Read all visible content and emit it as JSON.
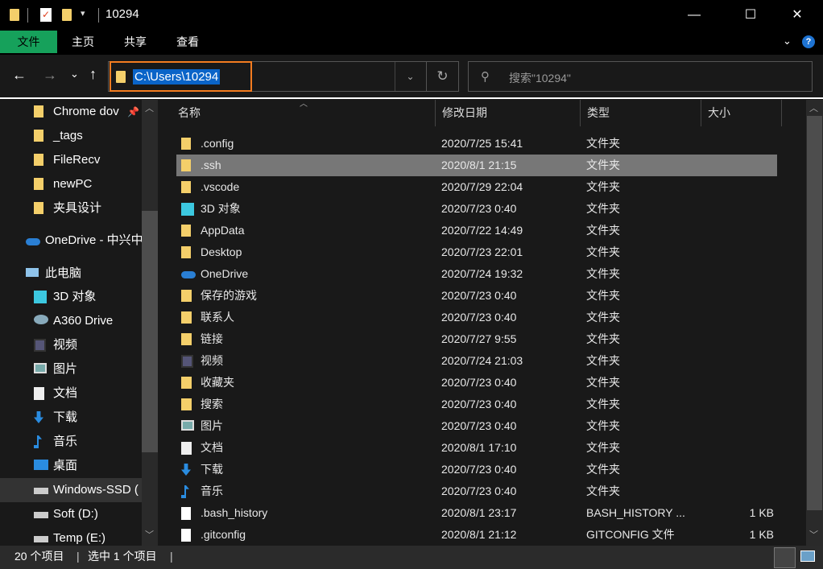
{
  "title": "10294",
  "ribbon": {
    "tabs": [
      "文件",
      "主页",
      "共享",
      "查看"
    ],
    "accent": "#16a15b"
  },
  "address": {
    "path": "C:\\Users\\10294",
    "search_placeholder": "搜索\"10294\"",
    "highlight": "#f47c20"
  },
  "sidebar": {
    "items": [
      {
        "label": "Chrome dov",
        "icon": "folder-icon",
        "pinned": true
      },
      {
        "label": "_tags",
        "icon": "folder-icon"
      },
      {
        "label": "FileRecv",
        "icon": "folder-icon"
      },
      {
        "label": "newPC",
        "icon": "folder-icon"
      },
      {
        "label": "夹具设计",
        "icon": "folder-icon"
      },
      {
        "label": "OneDrive - 中兴中",
        "icon": "onedrive-icon"
      },
      {
        "label": "此电脑",
        "icon": "computer-icon"
      },
      {
        "label": "3D 对象",
        "icon": "3d-objects-icon"
      },
      {
        "label": "A360 Drive",
        "icon": "a360-icon"
      },
      {
        "label": "视频",
        "icon": "video-icon"
      },
      {
        "label": "图片",
        "icon": "pictures-icon"
      },
      {
        "label": "文档",
        "icon": "documents-icon"
      },
      {
        "label": "下载",
        "icon": "download-icon"
      },
      {
        "label": "音乐",
        "icon": "music-icon"
      },
      {
        "label": "桌面",
        "icon": "desktop-icon"
      },
      {
        "label": "Windows-SSD (",
        "icon": "drive-icon",
        "selected": true
      },
      {
        "label": "Soft (D:)",
        "icon": "drive-icon"
      },
      {
        "label": "Temp  (E:)",
        "icon": "drive-icon"
      }
    ]
  },
  "columns": [
    "名称",
    "修改日期",
    "类型",
    "大小"
  ],
  "files": [
    {
      "name": ".config",
      "date": "2020/7/25 15:41",
      "type": "文件夹",
      "size": "",
      "icon": "folder-icon"
    },
    {
      "name": ".ssh",
      "date": "2020/8/1 21:15",
      "type": "文件夹",
      "size": "",
      "icon": "folder-icon",
      "selected": true
    },
    {
      "name": ".vscode",
      "date": "2020/7/29 22:04",
      "type": "文件夹",
      "size": "",
      "icon": "folder-icon"
    },
    {
      "name": "3D 对象",
      "date": "2020/7/23 0:40",
      "type": "文件夹",
      "size": "",
      "icon": "3d-objects-icon"
    },
    {
      "name": "AppData",
      "date": "2020/7/22 14:49",
      "type": "文件夹",
      "size": "",
      "icon": "folder-icon"
    },
    {
      "name": "Desktop",
      "date": "2020/7/23 22:01",
      "type": "文件夹",
      "size": "",
      "icon": "folder-icon"
    },
    {
      "name": "OneDrive",
      "date": "2020/7/24 19:32",
      "type": "文件夹",
      "size": "",
      "icon": "onedrive-icon"
    },
    {
      "name": "保存的游戏",
      "date": "2020/7/23 0:40",
      "type": "文件夹",
      "size": "",
      "icon": "saved-games-icon"
    },
    {
      "name": "联系人",
      "date": "2020/7/23 0:40",
      "type": "文件夹",
      "size": "",
      "icon": "contacts-icon"
    },
    {
      "name": "链接",
      "date": "2020/7/27 9:55",
      "type": "文件夹",
      "size": "",
      "icon": "links-icon"
    },
    {
      "name": "视频",
      "date": "2020/7/24 21:03",
      "type": "文件夹",
      "size": "",
      "icon": "video-icon"
    },
    {
      "name": "收藏夹",
      "date": "2020/7/23 0:40",
      "type": "文件夹",
      "size": "",
      "icon": "favorites-icon"
    },
    {
      "name": "搜索",
      "date": "2020/7/23 0:40",
      "type": "文件夹",
      "size": "",
      "icon": "search-folder-icon"
    },
    {
      "name": "图片",
      "date": "2020/7/23 0:40",
      "type": "文件夹",
      "size": "",
      "icon": "pictures-icon"
    },
    {
      "name": "文档",
      "date": "2020/8/1 17:10",
      "type": "文件夹",
      "size": "",
      "icon": "documents-icon"
    },
    {
      "name": "下载",
      "date": "2020/7/23 0:40",
      "type": "文件夹",
      "size": "",
      "icon": "download-icon"
    },
    {
      "name": "音乐",
      "date": "2020/7/23 0:40",
      "type": "文件夹",
      "size": "",
      "icon": "music-icon"
    },
    {
      "name": ".bash_history",
      "date": "2020/8/1 23:17",
      "type": "BASH_HISTORY ...",
      "size": "1 KB",
      "icon": "file-icon"
    },
    {
      "name": ".gitconfig",
      "date": "2020/8/1 21:12",
      "type": "GITCONFIG 文件",
      "size": "1 KB",
      "icon": "file-icon"
    }
  ],
  "status": {
    "count": "20 个项目",
    "selected": "选中 1 个项目"
  }
}
